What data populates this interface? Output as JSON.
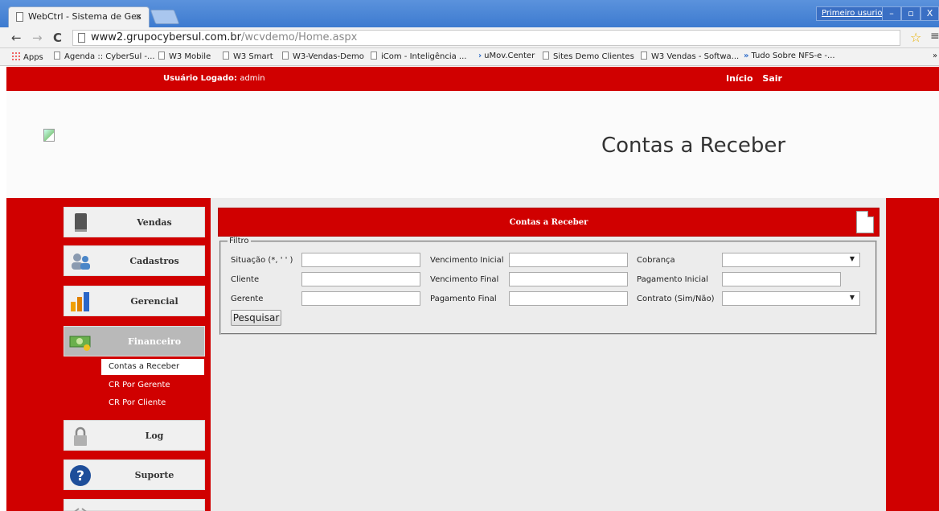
{
  "browser": {
    "tab_title": "WebCtrl - Sistema de Ges",
    "tab_close": "×",
    "user_button": "Primeiro usurio",
    "window_controls": [
      "–",
      "▫",
      "X"
    ],
    "url_host": "www2.grupocybersul.com.br",
    "url_path": "/wcvdemo/Home.aspx",
    "nav_back": "←",
    "nav_forward": "→",
    "nav_reload": "C",
    "star": "☆",
    "menu": "≡",
    "bookmarks": [
      "Apps",
      "Agenda :: CyberSul -...",
      "W3 Mobile",
      "W3 Smart",
      "W3-Vendas-Demo",
      "iCom - Inteligência ...",
      "uMov.Center",
      "Sites Demo Clientes",
      "W3 Vendas - Softwa...",
      "Tudo Sobre NFS-e -..."
    ],
    "bookmarks_overflow": "»"
  },
  "topbar": {
    "logged_label": "Usuário Logado:",
    "logged_user": "admin",
    "link_home": "Início",
    "link_exit": "Sair"
  },
  "header": {
    "title": "Contas a Receber"
  },
  "sidebar": {
    "items": [
      {
        "label": "Vendas",
        "icon": "book-icon"
      },
      {
        "label": "Cadastros",
        "icon": "users-icon"
      },
      {
        "label": "Gerencial",
        "icon": "bar-chart-icon"
      },
      {
        "label": "Financeiro",
        "icon": "money-icon"
      },
      {
        "label": "Log",
        "icon": "lock-icon"
      },
      {
        "label": "Suporte",
        "icon": "help-icon"
      }
    ],
    "sub_items": [
      "Contas a Receber",
      "CR Por Gerente",
      "CR Por Cliente"
    ],
    "active": "Financeiro",
    "colors": {
      "brand": "#d00000",
      "content_bg": "#ececec"
    }
  },
  "panel": {
    "title": "Contas a Receber",
    "filter_legend": "Filtro",
    "fields": {
      "situacao": "Situação (*, ' ' )",
      "cliente": "Cliente",
      "gerente": "Gerente",
      "venc_inicial": "Vencimento Inicial",
      "venc_final": "Vencimento Final",
      "pag_final": "Pagamento Final",
      "cobranca": "Cobrança",
      "pag_inicial": "Pagamento Inicial",
      "contrato": "Contrato (Sim/Não)"
    },
    "values": {
      "situacao": "",
      "cliente": "",
      "gerente": "",
      "venc_inicial": "",
      "venc_final": "",
      "pag_final": "",
      "cobranca": "",
      "pag_inicial": "",
      "contrato": ""
    },
    "search_button": "Pesquisar"
  }
}
